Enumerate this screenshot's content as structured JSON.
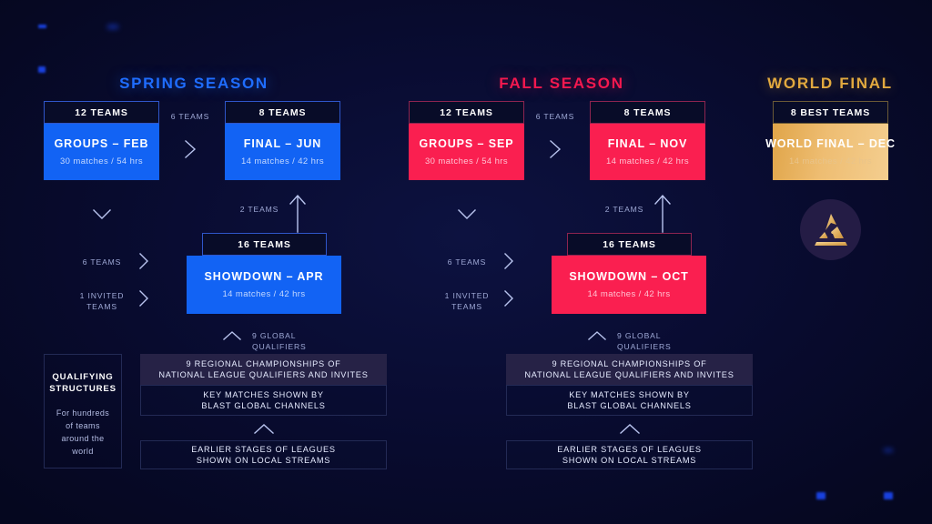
{
  "colors": {
    "background": "#070a2a",
    "spring_accent": "#1f6dff",
    "spring_box": "#1263f4",
    "fall_accent": "#f5184f",
    "fall_box": "#fa1f50",
    "world_accent": "#e2a93f",
    "world_box": "#e0a549",
    "muted_text": "#9fa9d6",
    "band_fill": "#262246"
  },
  "seasons": {
    "spring": {
      "title": "SPRING SEASON",
      "groups": {
        "teams": "12 TEAMS",
        "name": "GROUPS – FEB",
        "meta": "30 matches / 54 hrs"
      },
      "final": {
        "teams": "8 TEAMS",
        "name": "FINAL – JUN",
        "meta": "14 matches / 42 hrs"
      },
      "showdown": {
        "teams": "16 TEAMS",
        "name": "SHOWDOWN – APR",
        "meta": "14 matches / 42 hrs"
      },
      "flow": {
        "groups_to_final": "6 TEAMS",
        "showdown_to_final": "2 TEAMS",
        "groups_to_showdown": "6 TEAMS",
        "invited": "1 INVITED\nTEAMS",
        "invited_line1": "1 INVITED",
        "invited_line2": "TEAMS",
        "global_qualifiers_line1": "9 GLOBAL",
        "global_qualifiers_line2": "QUALIFIERS"
      },
      "qualifiers": {
        "regional_line1": "9 REGIONAL CHAMPIONSHIPS OF",
        "regional_line2": "NATIONAL LEAGUE QUALIFIERS AND INVITES",
        "key_line1": "KEY MATCHES SHOWN BY",
        "key_line2": "BLAST GLOBAL CHANNELS",
        "earlier_line1": "EARLIER STAGES OF LEAGUES",
        "earlier_line2": "SHOWN ON LOCAL STREAMS"
      }
    },
    "fall": {
      "title": "FALL SEASON",
      "groups": {
        "teams": "12 TEAMS",
        "name": "GROUPS – SEP",
        "meta": "30 matches / 54 hrs"
      },
      "final": {
        "teams": "8 TEAMS",
        "name": "FINAL – NOV",
        "meta": "14 matches / 42 hrs"
      },
      "showdown": {
        "teams": "16 TEAMS",
        "name": "SHOWDOWN – OCT",
        "meta": "14 matches / 42 hrs"
      },
      "flow": {
        "groups_to_final": "6 TEAMS",
        "showdown_to_final": "2 TEAMS",
        "groups_to_showdown": "6 TEAMS",
        "invited_line1": "1 INVITED",
        "invited_line2": "TEAMS",
        "global_qualifiers_line1": "9 GLOBAL",
        "global_qualifiers_line2": "QUALIFIERS"
      },
      "qualifiers": {
        "regional_line1": "9 REGIONAL CHAMPIONSHIPS OF",
        "regional_line2": "NATIONAL LEAGUE QUALIFIERS AND INVITES",
        "key_line1": "KEY MATCHES SHOWN BY",
        "key_line2": "BLAST GLOBAL CHANNELS",
        "earlier_line1": "EARLIER STAGES OF LEAGUES",
        "earlier_line2": "SHOWN ON LOCAL STREAMS"
      }
    },
    "world": {
      "title": "WORLD FINAL",
      "final": {
        "teams": "8 BEST TEAMS",
        "name": "WORLD FINAL – DEC",
        "meta": "14 matches / 42 hrs"
      }
    }
  },
  "qualifying_structures": {
    "title_line1": "QUALIFYING",
    "title_line2": "STRUCTURES",
    "description_line1": "For hundreds",
    "description_line2": "of teams",
    "description_line3": "around the",
    "description_line4": "world"
  }
}
